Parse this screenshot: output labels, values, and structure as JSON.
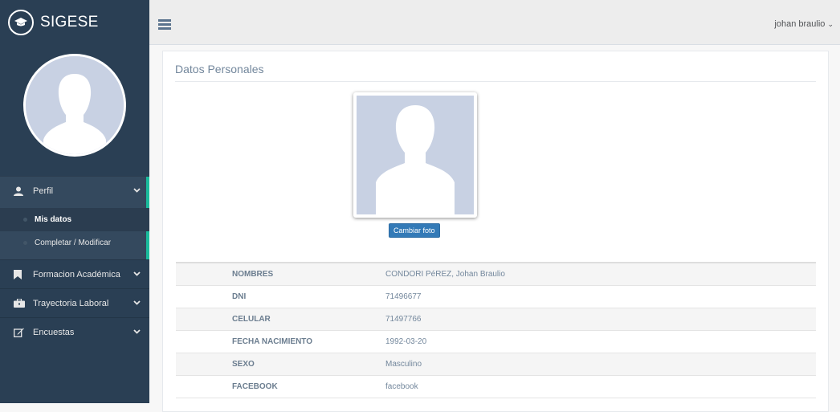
{
  "app": {
    "title": "SIGESE"
  },
  "topbar": {
    "user": "johan braulio"
  },
  "sidebar": {
    "menu": [
      {
        "label": "Perfil",
        "icon": "user-icon"
      },
      {
        "label": "Formacion Académica",
        "icon": "bookmark-icon"
      },
      {
        "label": "Trayectoria Laboral",
        "icon": "briefcase-icon"
      },
      {
        "label": "Encuestas",
        "icon": "edit-icon"
      }
    ],
    "submenu": [
      {
        "label": "Mis datos"
      },
      {
        "label": "Completar / Modificar"
      }
    ]
  },
  "main": {
    "title": "Datos Personales",
    "change_photo": "Cambiar foto",
    "fields": [
      {
        "key": "NOMBRES",
        "value": "CONDORI PéREZ, Johan Braulio"
      },
      {
        "key": "DNI",
        "value": "71496677"
      },
      {
        "key": "CELULAR",
        "value": "71497766"
      },
      {
        "key": "FECHA NACIMIENTO",
        "value": "1992-03-20"
      },
      {
        "key": "SEXO",
        "value": "Masculino"
      },
      {
        "key": "FACEBOOK",
        "value": "facebook"
      }
    ]
  },
  "colors": {
    "sidebar": "#2a3f54",
    "accent": "#1abb9c",
    "button": "#337ab7"
  }
}
